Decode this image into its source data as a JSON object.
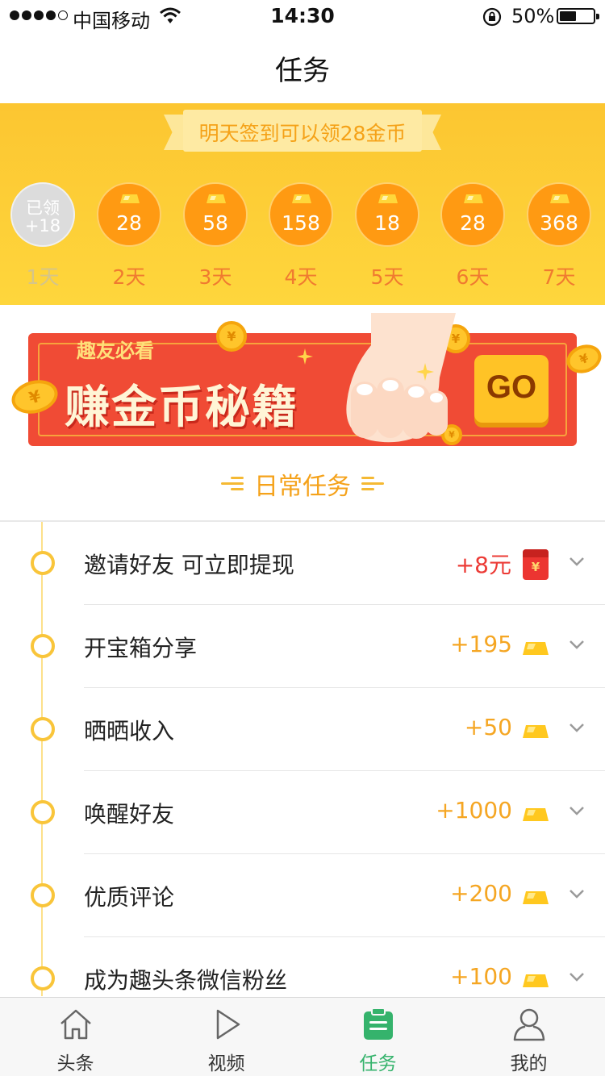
{
  "status_bar": {
    "carrier": "中国移动",
    "time": "14:30",
    "battery": "50%",
    "battery_level": 0.5,
    "signal_strength": 4
  },
  "nav": {
    "title": "任务"
  },
  "signin": {
    "notice": "明天签到可以领28金币",
    "days": [
      {
        "claimed_label": "已领",
        "amount": "+18",
        "label": "1天",
        "claimed": true
      },
      {
        "amount": "28",
        "label": "2天",
        "claimed": false
      },
      {
        "amount": "58",
        "label": "3天",
        "claimed": false
      },
      {
        "amount": "158",
        "label": "4天",
        "claimed": false
      },
      {
        "amount": "18",
        "label": "5天",
        "claimed": false
      },
      {
        "amount": "28",
        "label": "6天",
        "claimed": false
      },
      {
        "amount": "368",
        "label": "7天",
        "claimed": false
      }
    ]
  },
  "banner": {
    "tag": "趣友必看",
    "headline": "赚金币秘籍",
    "button": "GO"
  },
  "section": {
    "title": "日常任务"
  },
  "tasks": [
    {
      "name": "邀请好友 可立即提现",
      "reward": "+8元",
      "reward_type": "cash"
    },
    {
      "name": "开宝箱分享",
      "reward": "+195",
      "reward_type": "coin"
    },
    {
      "name": "晒晒收入",
      "reward": "+50",
      "reward_type": "coin"
    },
    {
      "name": "唤醒好友",
      "reward": "+1000",
      "reward_type": "coin"
    },
    {
      "name": "优质评论",
      "reward": "+200",
      "reward_type": "coin"
    },
    {
      "name": "成为趣头条微信粉丝",
      "reward": "+100",
      "reward_type": "coin"
    }
  ],
  "envelope_symbol": "¥",
  "tab_bar": {
    "tabs": [
      {
        "label": "头条",
        "icon": "home-icon",
        "active": false
      },
      {
        "label": "视频",
        "icon": "play-icon",
        "active": false
      },
      {
        "label": "任务",
        "icon": "clipboard-icon",
        "active": true
      },
      {
        "label": "我的",
        "icon": "user-icon",
        "active": false
      }
    ]
  },
  "colors": {
    "accent_yellow": "#fcc631",
    "coin_orange": "#ff9a12",
    "reward_orange": "#f5a623",
    "reward_red": "#ec3b36",
    "banner_red": "#f04b35",
    "tab_active_green": "#35b36c"
  }
}
